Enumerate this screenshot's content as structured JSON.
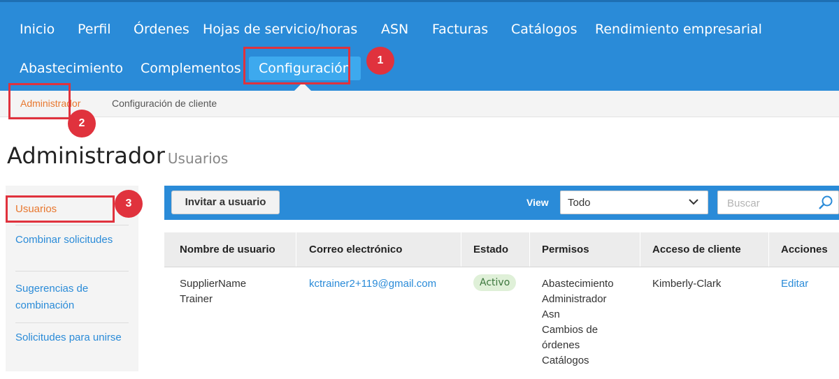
{
  "top_nav": {
    "items": [
      "Inicio",
      "Perfil",
      "Órdenes",
      "Hojas de servicio/horas",
      "ASN",
      "Facturas",
      "Catálogos",
      "Rendimiento empresarial",
      "Abastecimiento",
      "Complementos",
      "Configuración"
    ],
    "active": "Configuración"
  },
  "sub_nav": {
    "items": [
      "Administrador",
      "Configuración de cliente"
    ],
    "active": "Administrador"
  },
  "annotations": [
    "1",
    "2",
    "3"
  ],
  "page": {
    "title": "Administrador",
    "subtitle": "Usuarios"
  },
  "sidebar": {
    "items": [
      "Usuarios",
      "Combinar solicitudes",
      "Sugerencias de combinación",
      "Solicitudes para unirse"
    ],
    "active": "Usuarios"
  },
  "toolbar": {
    "invite_label": "Invitar a usuario",
    "view_label": "View",
    "view_value": "Todo",
    "search_placeholder": "Buscar"
  },
  "table": {
    "columns": [
      "Nombre de usuario",
      "Correo electrónico",
      "Estado",
      "Permisos",
      "Acceso de cliente",
      "Acciones"
    ],
    "rows": [
      {
        "name_line1": "SupplierName",
        "name_line2": "Trainer",
        "email": "kctrainer2+119@gmail.com",
        "status": "Activo",
        "permissions": [
          "Abastecimiento",
          "Administrador",
          "Asn",
          "Cambios de",
          "órdenes",
          "Catálogos"
        ],
        "customer_access": "Kimberly-Clark",
        "action": "Editar"
      }
    ]
  },
  "colors": {
    "nav_blue": "#2a8bd8",
    "active_tab": "#3da9ee",
    "active_orange": "#e8772e",
    "annotation_red": "#e0323d",
    "badge_green_bg": "#dff0d8"
  }
}
